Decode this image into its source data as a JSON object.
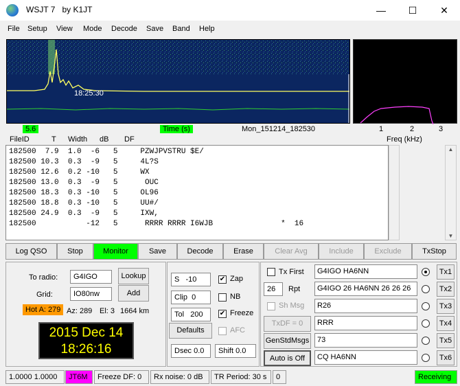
{
  "window": {
    "title": "WSJT 7",
    "author": "by K1JT",
    "minimize": "—",
    "maximize": "☐",
    "close": "✕"
  },
  "menu": [
    "File",
    "Setup",
    "View",
    "Mode",
    "Decode",
    "Save",
    "Band",
    "Help"
  ],
  "display": {
    "waterfall_time": "18:25:30",
    "scale_left": "5.6",
    "time_label": "Time (s)",
    "file_label": "Mon_151214_182530",
    "freq_ticks": [
      "1",
      "2",
      "3"
    ],
    "freq_label": "Freq (kHz)"
  },
  "decoded": {
    "headers": [
      "FileID",
      "T",
      "Width",
      "dB",
      "DF"
    ],
    "lines": [
      "182500  7.9  1.0  -6   5     PZWJPVSTRU $E/",
      "182500 10.3  0.3  -9   5     4L?S",
      "182500 12.6  0.2 -10   5     WX",
      "182500 13.0  0.3  -9   5      OUC",
      "182500 18.3  0.3 -10   5     OL96",
      "182500 18.8  0.3 -10   5     UU#/",
      "182500 24.9  0.3  -9   5     IXW,",
      "182500           -12   5      RRRR RRRR I6WJB               *  16"
    ]
  },
  "toolbar": {
    "log_qso": "Log QSO",
    "stop": "Stop",
    "monitor": "Monitor",
    "save": "Save",
    "decode": "Decode",
    "erase": "Erase",
    "clear_avg": "Clear Avg",
    "include": "Include",
    "exclude": "Exclude",
    "txstop": "TxStop"
  },
  "station": {
    "to_radio_label": "To radio:",
    "to_radio": "G4IGO",
    "lookup": "Lookup",
    "grid_label": "Grid:",
    "grid": "IO80nw",
    "add": "Add",
    "hot_a": "Hot A: 279",
    "az": "Az: 289",
    "el": "El: 3",
    "dist": "1664 km",
    "date": "2015 Dec 14",
    "time": "18:26:16"
  },
  "params": {
    "s_label": "S",
    "s_value": "-10",
    "zap": "Zap",
    "clip_label": "Clip",
    "clip_value": "0",
    "nb": "NB",
    "tol_label": "Tol",
    "tol_value": "200",
    "freeze": "Freeze",
    "defaults": "Defaults",
    "afc": "AFC",
    "dsec": "Dsec  0.0",
    "shift": "Shift 0.0"
  },
  "tx": {
    "tx_first": "Tx First",
    "rpt_value": "26",
    "rpt_label": "Rpt",
    "sh_msg": "Sh Msg",
    "txdf": "TxDF = 0",
    "gen_std": "GenStdMsgs",
    "auto": "Auto is Off",
    "messages": [
      "G4IGO HA6NN",
      "G4IGO 26 HA6NN 26 26 26",
      "R26",
      "RRR",
      "73",
      "CQ HA6NN"
    ],
    "buttons": [
      "Tx1",
      "Tx2",
      "Tx3",
      "Tx4",
      "Tx5",
      "Tx6"
    ]
  },
  "status": {
    "levels": "1.0000 1.0000",
    "mode": "JT6M",
    "freeze_df": "Freeze DF:  0",
    "rx_noise": "Rx noise:  0 dB",
    "tr_period": "TR Period: 30 s",
    "count": "0",
    "state": "Receiving"
  },
  "colors": {
    "green": "#00ff00",
    "magenta": "#ff00ff",
    "hot": "#ff9900",
    "clock": "#ffff00"
  }
}
